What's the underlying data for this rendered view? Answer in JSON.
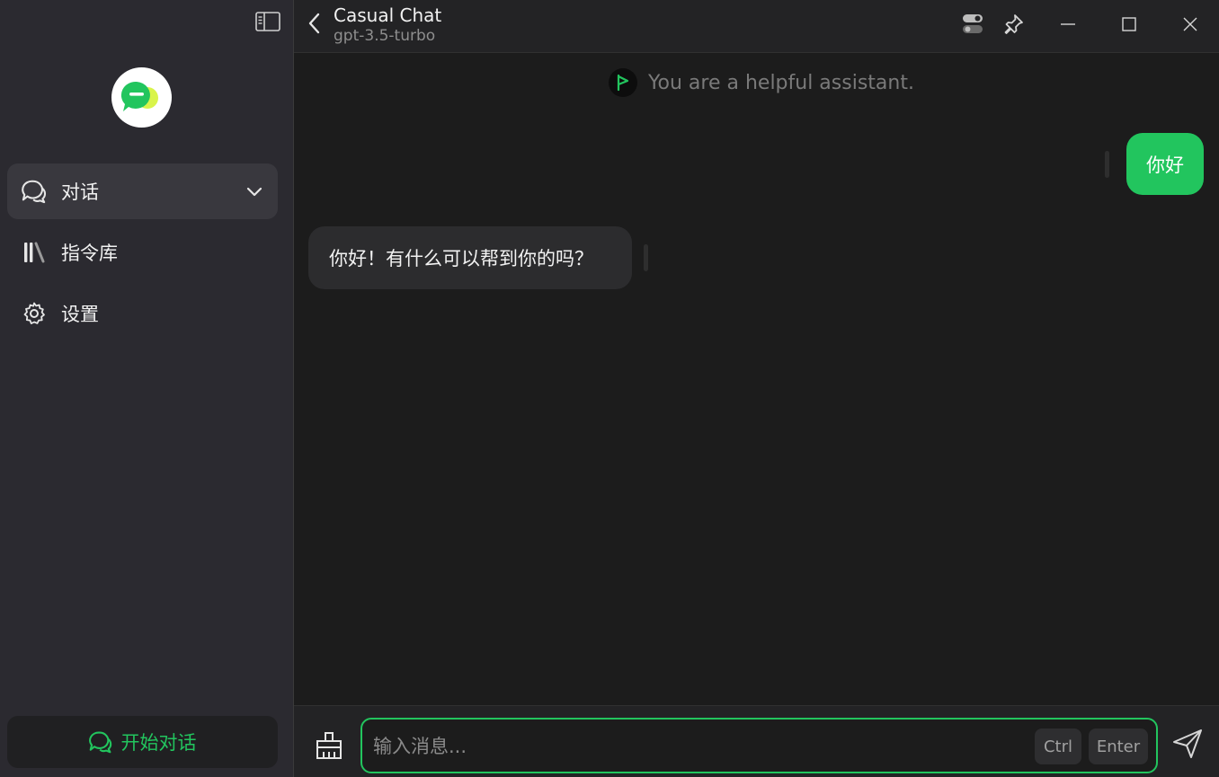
{
  "sidebar": {
    "nav": [
      {
        "label": "对话",
        "icon": "chat-bubbles-icon",
        "active": true
      },
      {
        "label": "指令库",
        "icon": "library-icon",
        "active": false
      },
      {
        "label": "设置",
        "icon": "gear-icon",
        "active": false
      }
    ],
    "start_button": "开始对话"
  },
  "header": {
    "title": "Casual Chat",
    "model": "gpt-3.5-turbo"
  },
  "conversation": {
    "system_prompt": "You are a helpful assistant.",
    "messages": [
      {
        "role": "user",
        "text": "你好"
      },
      {
        "role": "assistant",
        "text": "你好！有什么可以帮到你的吗？"
      }
    ]
  },
  "composer": {
    "placeholder": "输入消息...",
    "shortcut_keys": [
      "Ctrl",
      "Enter"
    ]
  },
  "colors": {
    "accent": "#22c55e",
    "sidebar_bg": "#2b2a30",
    "main_bg": "#1c1c1c"
  }
}
